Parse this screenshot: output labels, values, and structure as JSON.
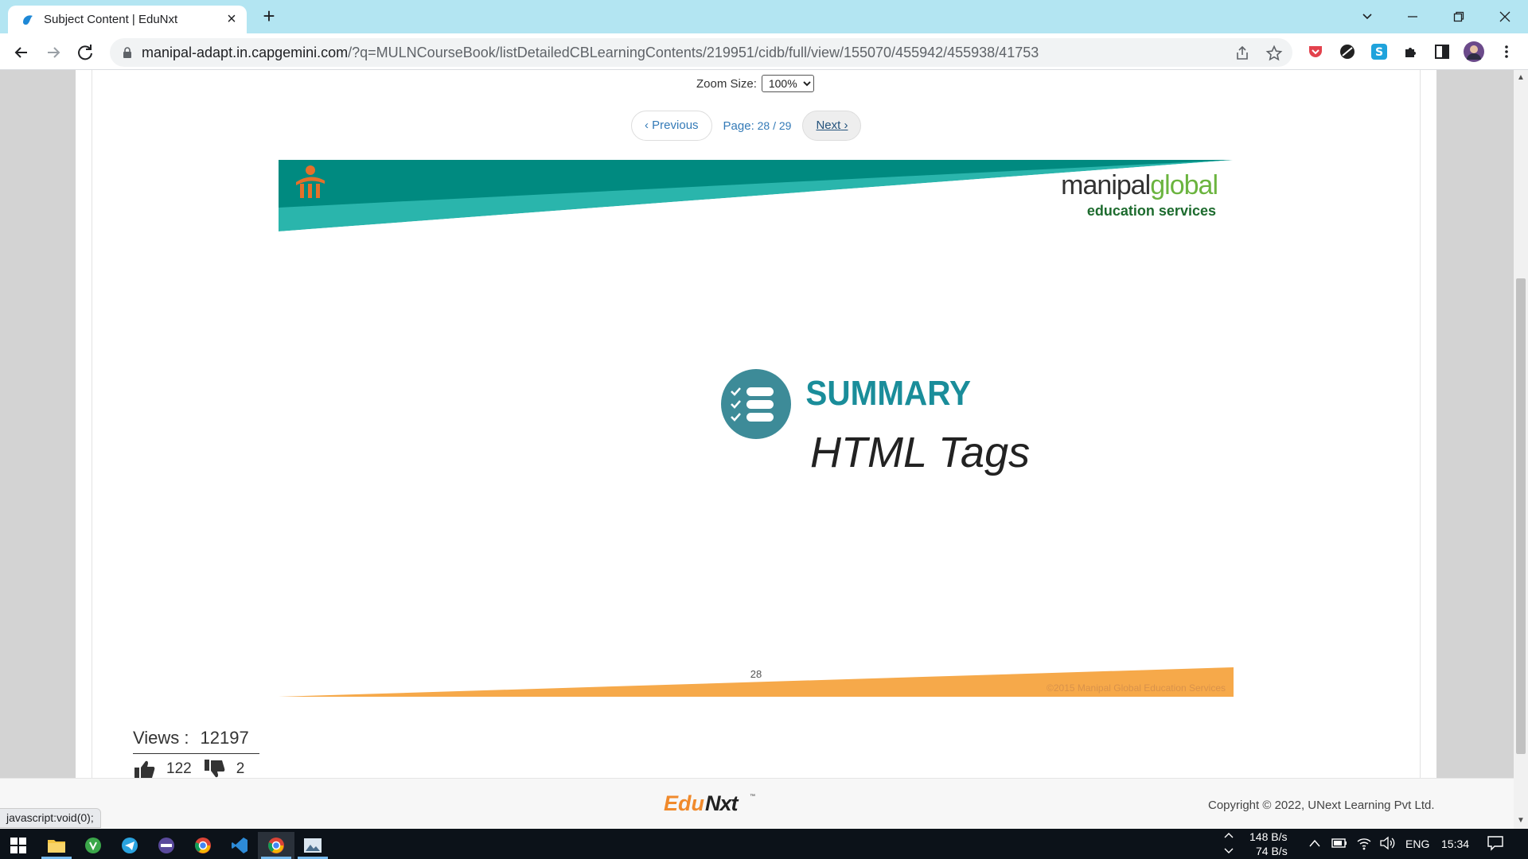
{
  "browser": {
    "tab_title": "Subject Content | EduNxt",
    "url_domain": "manipal-adapt.in.capgemini.com",
    "url_path": "/?q=MULNCourseBook/listDetailedCBLearningContents/219951/cidb/full/view/155070/455942/455938/41753"
  },
  "viewer": {
    "zoom_label": "Zoom Size:",
    "zoom_value": "100%",
    "zoom_options": [
      "100%"
    ],
    "prev_label": "Previous",
    "page_label": "Page:",
    "page_value": "28 / 29",
    "next_label": "Next"
  },
  "slide": {
    "brand_main": "manipal",
    "brand_accent": "global",
    "brand_sub": "education services",
    "heading": "SUMMARY",
    "subheading": "HTML Tags",
    "page_number": "28",
    "copyright": "©2015 Manipal Global Education Services",
    "colors": {
      "teal": "#008a80",
      "teal_light": "#2ab5ac",
      "orange": "#f6a94a",
      "summary_blue": "#1a8d9a"
    }
  },
  "stats": {
    "views_label": "Views :",
    "views_value": "12197",
    "likes": "122",
    "dislikes": "2"
  },
  "footer": {
    "logo_edu": "Edu",
    "logo_nxt": "Nxt",
    "copyright": "Copyright © 2022, UNext Learning Pvt Ltd.",
    "status_tip": "javascript:void(0);"
  },
  "taskbar": {
    "net_up": "148 B/s",
    "net_down": "74 B/s",
    "language": "ENG",
    "time": "15:34"
  }
}
